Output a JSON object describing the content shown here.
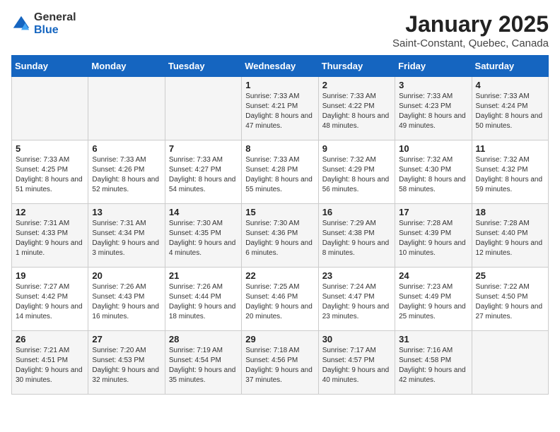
{
  "header": {
    "logo_general": "General",
    "logo_blue": "Blue",
    "title": "January 2025",
    "subtitle": "Saint-Constant, Quebec, Canada"
  },
  "weekdays": [
    "Sunday",
    "Monday",
    "Tuesday",
    "Wednesday",
    "Thursday",
    "Friday",
    "Saturday"
  ],
  "weeks": [
    [
      {
        "day": "",
        "info": ""
      },
      {
        "day": "",
        "info": ""
      },
      {
        "day": "",
        "info": ""
      },
      {
        "day": "1",
        "info": "Sunrise: 7:33 AM\nSunset: 4:21 PM\nDaylight: 8 hours and 47 minutes."
      },
      {
        "day": "2",
        "info": "Sunrise: 7:33 AM\nSunset: 4:22 PM\nDaylight: 8 hours and 48 minutes."
      },
      {
        "day": "3",
        "info": "Sunrise: 7:33 AM\nSunset: 4:23 PM\nDaylight: 8 hours and 49 minutes."
      },
      {
        "day": "4",
        "info": "Sunrise: 7:33 AM\nSunset: 4:24 PM\nDaylight: 8 hours and 50 minutes."
      }
    ],
    [
      {
        "day": "5",
        "info": "Sunrise: 7:33 AM\nSunset: 4:25 PM\nDaylight: 8 hours and 51 minutes."
      },
      {
        "day": "6",
        "info": "Sunrise: 7:33 AM\nSunset: 4:26 PM\nDaylight: 8 hours and 52 minutes."
      },
      {
        "day": "7",
        "info": "Sunrise: 7:33 AM\nSunset: 4:27 PM\nDaylight: 8 hours and 54 minutes."
      },
      {
        "day": "8",
        "info": "Sunrise: 7:33 AM\nSunset: 4:28 PM\nDaylight: 8 hours and 55 minutes."
      },
      {
        "day": "9",
        "info": "Sunrise: 7:32 AM\nSunset: 4:29 PM\nDaylight: 8 hours and 56 minutes."
      },
      {
        "day": "10",
        "info": "Sunrise: 7:32 AM\nSunset: 4:30 PM\nDaylight: 8 hours and 58 minutes."
      },
      {
        "day": "11",
        "info": "Sunrise: 7:32 AM\nSunset: 4:32 PM\nDaylight: 8 hours and 59 minutes."
      }
    ],
    [
      {
        "day": "12",
        "info": "Sunrise: 7:31 AM\nSunset: 4:33 PM\nDaylight: 9 hours and 1 minute."
      },
      {
        "day": "13",
        "info": "Sunrise: 7:31 AM\nSunset: 4:34 PM\nDaylight: 9 hours and 3 minutes."
      },
      {
        "day": "14",
        "info": "Sunrise: 7:30 AM\nSunset: 4:35 PM\nDaylight: 9 hours and 4 minutes."
      },
      {
        "day": "15",
        "info": "Sunrise: 7:30 AM\nSunset: 4:36 PM\nDaylight: 9 hours and 6 minutes."
      },
      {
        "day": "16",
        "info": "Sunrise: 7:29 AM\nSunset: 4:38 PM\nDaylight: 9 hours and 8 minutes."
      },
      {
        "day": "17",
        "info": "Sunrise: 7:28 AM\nSunset: 4:39 PM\nDaylight: 9 hours and 10 minutes."
      },
      {
        "day": "18",
        "info": "Sunrise: 7:28 AM\nSunset: 4:40 PM\nDaylight: 9 hours and 12 minutes."
      }
    ],
    [
      {
        "day": "19",
        "info": "Sunrise: 7:27 AM\nSunset: 4:42 PM\nDaylight: 9 hours and 14 minutes."
      },
      {
        "day": "20",
        "info": "Sunrise: 7:26 AM\nSunset: 4:43 PM\nDaylight: 9 hours and 16 minutes."
      },
      {
        "day": "21",
        "info": "Sunrise: 7:26 AM\nSunset: 4:44 PM\nDaylight: 9 hours and 18 minutes."
      },
      {
        "day": "22",
        "info": "Sunrise: 7:25 AM\nSunset: 4:46 PM\nDaylight: 9 hours and 20 minutes."
      },
      {
        "day": "23",
        "info": "Sunrise: 7:24 AM\nSunset: 4:47 PM\nDaylight: 9 hours and 23 minutes."
      },
      {
        "day": "24",
        "info": "Sunrise: 7:23 AM\nSunset: 4:49 PM\nDaylight: 9 hours and 25 minutes."
      },
      {
        "day": "25",
        "info": "Sunrise: 7:22 AM\nSunset: 4:50 PM\nDaylight: 9 hours and 27 minutes."
      }
    ],
    [
      {
        "day": "26",
        "info": "Sunrise: 7:21 AM\nSunset: 4:51 PM\nDaylight: 9 hours and 30 minutes."
      },
      {
        "day": "27",
        "info": "Sunrise: 7:20 AM\nSunset: 4:53 PM\nDaylight: 9 hours and 32 minutes."
      },
      {
        "day": "28",
        "info": "Sunrise: 7:19 AM\nSunset: 4:54 PM\nDaylight: 9 hours and 35 minutes."
      },
      {
        "day": "29",
        "info": "Sunrise: 7:18 AM\nSunset: 4:56 PM\nDaylight: 9 hours and 37 minutes."
      },
      {
        "day": "30",
        "info": "Sunrise: 7:17 AM\nSunset: 4:57 PM\nDaylight: 9 hours and 40 minutes."
      },
      {
        "day": "31",
        "info": "Sunrise: 7:16 AM\nSunset: 4:58 PM\nDaylight: 9 hours and 42 minutes."
      },
      {
        "day": "",
        "info": ""
      }
    ]
  ]
}
